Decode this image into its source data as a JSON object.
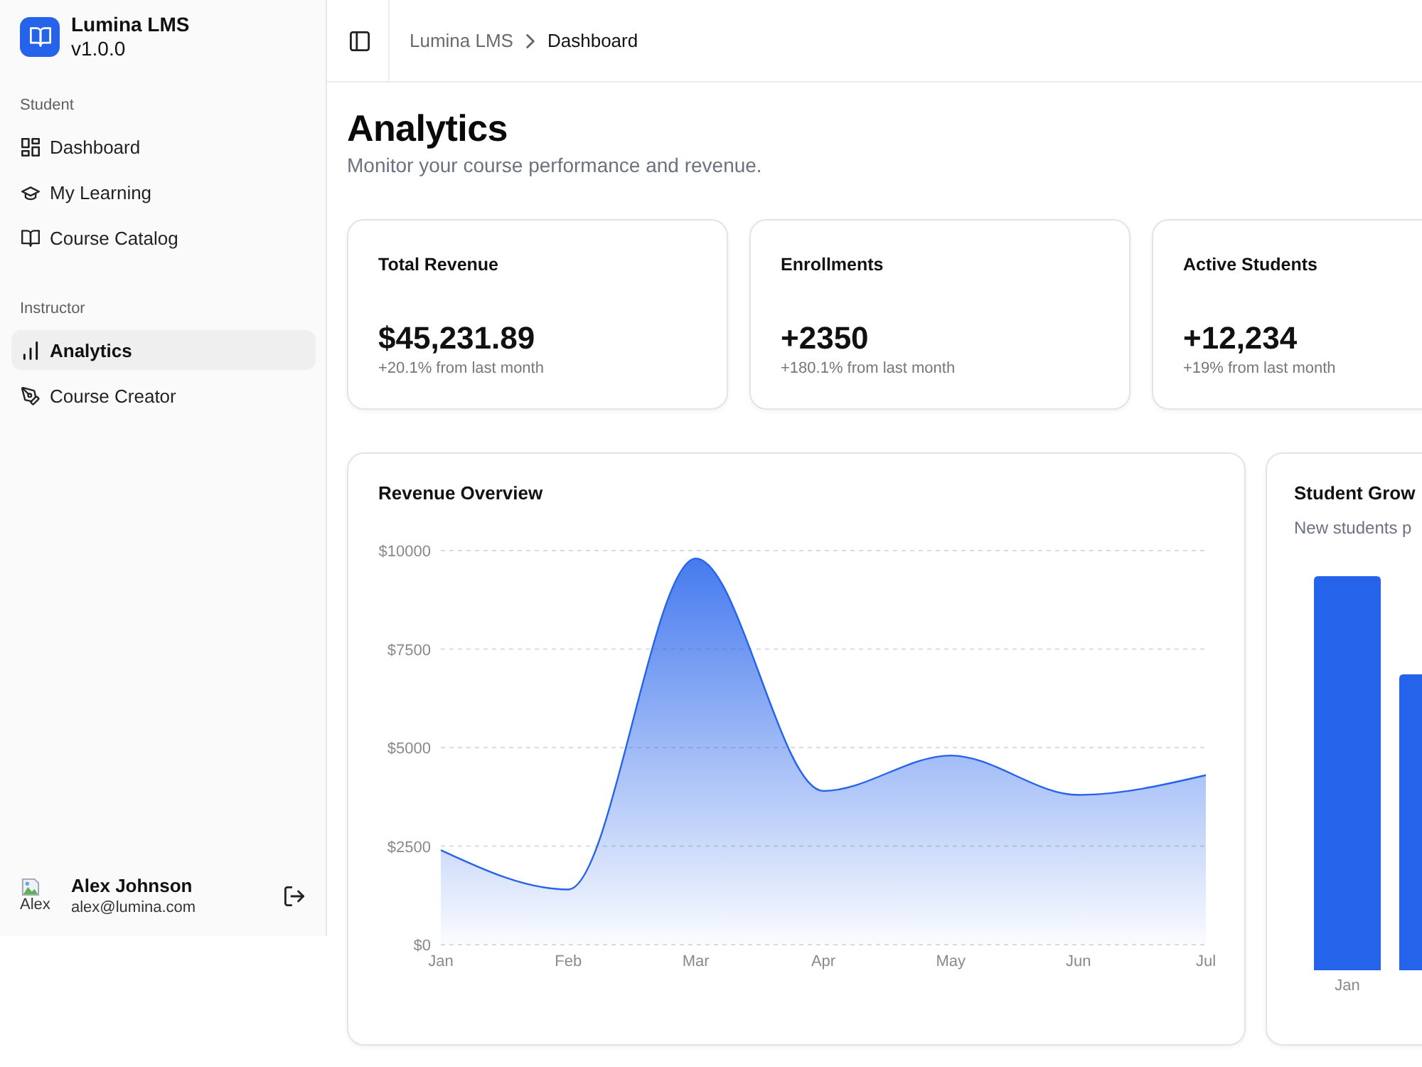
{
  "sidebar": {
    "brand": {
      "name": "Lumina LMS",
      "version": "v1.0.0"
    },
    "groups": [
      {
        "label": "Student",
        "items": [
          {
            "label": "Dashboard",
            "selected": false
          },
          {
            "label": "My Learning",
            "selected": false
          },
          {
            "label": "Course Catalog",
            "selected": false
          }
        ]
      },
      {
        "label": "Instructor",
        "items": [
          {
            "label": "Analytics",
            "selected": true
          },
          {
            "label": "Course Creator",
            "selected": false
          }
        ]
      }
    ],
    "user": {
      "avatar_alt": "Alex",
      "name": "Alex Johnson",
      "email": "alex@lumina.com"
    }
  },
  "header": {
    "breadcrumb": [
      {
        "label": "Lumina LMS",
        "current": false
      },
      {
        "label": "Dashboard",
        "current": true
      }
    ]
  },
  "page": {
    "title": "Analytics",
    "subtitle": "Monitor your course performance and revenue."
  },
  "stats": [
    {
      "label": "Total Revenue",
      "value": "$45,231.89",
      "change": "+20.1% from last month"
    },
    {
      "label": "Enrollments",
      "value": "+2350",
      "change": "+180.1% from last month"
    },
    {
      "label": "Active Students",
      "value": "+12,234",
      "change": "+19% from last month"
    }
  ],
  "revenue_card": {
    "chart_data": {
      "type": "area",
      "title": "Revenue Overview",
      "categories": [
        "Jan",
        "Feb",
        "Mar",
        "Apr",
        "May",
        "Jun",
        "Jul"
      ],
      "series": [
        {
          "color": "#2563eb",
          "values": [
            2400,
            1400,
            9800,
            3900,
            4800,
            3800,
            4300
          ]
        }
      ],
      "ylim": [
        0,
        10000
      ],
      "yticks": [
        {
          "value": 0,
          "label": "$0"
        },
        {
          "value": 2500,
          "label": "$2500"
        },
        {
          "value": 5000,
          "label": "$5000"
        },
        {
          "value": 7500,
          "label": "$7500"
        },
        {
          "value": 10000,
          "label": "$10000"
        }
      ],
      "grid": true
    }
  },
  "student_growth_card": {
    "title": "Student Grow",
    "subtitle": "New students p",
    "x_labels": [
      "Jan"
    ]
  }
}
